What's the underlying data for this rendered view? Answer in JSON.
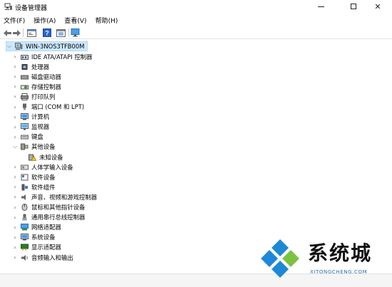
{
  "window": {
    "title": "设备管理器",
    "minimize_icon": "minimize-icon",
    "maximize_icon": "maximize-icon",
    "close_glyph": "✕"
  },
  "menu": {
    "items": [
      {
        "label": "文件(F)"
      },
      {
        "label": "操作(A)"
      },
      {
        "label": "查看(V)"
      },
      {
        "label": "帮助(H)"
      }
    ]
  },
  "toolbar": {
    "buttons": [
      {
        "icon": "back-arrow-icon"
      },
      {
        "icon": "forward-arrow-icon"
      },
      {
        "icon": "properties-icon"
      },
      {
        "icon": "help-icon"
      },
      {
        "icon": "update-driver-icon"
      },
      {
        "icon": "scan-hardware-icon"
      }
    ]
  },
  "tree": {
    "root": {
      "label": "WIN-3NOS3TFB00M",
      "expander": "⌵"
    },
    "items": [
      {
        "label": "IDE ATA/ATAPI 控制器",
        "expander": "›",
        "icon": "ide-controller-icon"
      },
      {
        "label": "处理器",
        "expander": "›",
        "icon": "processor-icon"
      },
      {
        "label": "磁盘驱动器",
        "expander": "›",
        "icon": "disk-drive-icon"
      },
      {
        "label": "存储控制器",
        "expander": "›",
        "icon": "storage-controller-icon"
      },
      {
        "label": "打印队列",
        "expander": "›",
        "icon": "printer-icon"
      },
      {
        "label": "端口 (COM 和 LPT)",
        "expander": "›",
        "icon": "port-icon"
      },
      {
        "label": "计算机",
        "expander": "›",
        "icon": "computer-icon"
      },
      {
        "label": "监视器",
        "expander": "›",
        "icon": "monitor-icon"
      },
      {
        "label": "键盘",
        "expander": "›",
        "icon": "keyboard-icon"
      },
      {
        "label": "其他设备",
        "expander": "⌵",
        "icon": "other-devices-icon"
      },
      {
        "label": "未知设备",
        "expander": "",
        "icon": "unknown-device-warning-icon"
      },
      {
        "label": "人体学输入设备",
        "expander": "›",
        "icon": "hid-icon"
      },
      {
        "label": "软件设备",
        "expander": "›",
        "icon": "software-device-icon"
      },
      {
        "label": "软件组件",
        "expander": "›",
        "icon": "software-component-icon"
      },
      {
        "label": "声音、视频和游戏控制器",
        "expander": "›",
        "icon": "sound-icon"
      },
      {
        "label": "鼠标和其他指针设备",
        "expander": "›",
        "icon": "mouse-icon"
      },
      {
        "label": "通用串行总线控制器",
        "expander": "›",
        "icon": "usb-icon"
      },
      {
        "label": "网络适配器",
        "expander": "›",
        "icon": "network-adapter-icon"
      },
      {
        "label": "系统设备",
        "expander": "›",
        "icon": "system-device-icon"
      },
      {
        "label": "显示适配器",
        "expander": "›",
        "icon": "display-adapter-icon"
      },
      {
        "label": "音频输入和输出",
        "expander": "›",
        "icon": "audio-io-icon"
      }
    ]
  },
  "watermark": {
    "title": "系统城",
    "subtitle": "XITONGCHENG.COM",
    "logo": "xitongcheng-logo-icon"
  },
  "colors": {
    "selection": "#cce8ff",
    "watermark_blue": "#1e88d6",
    "watermark_green": "#7cc242"
  }
}
